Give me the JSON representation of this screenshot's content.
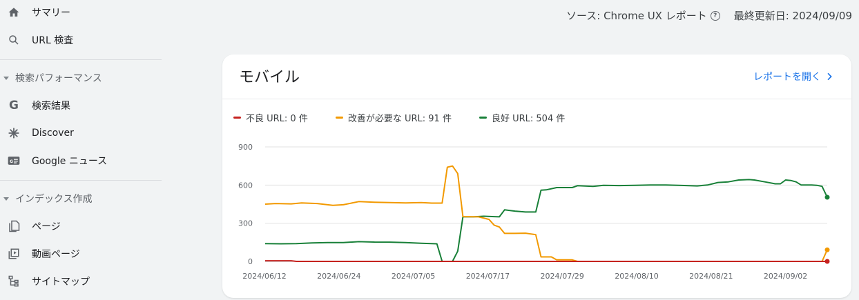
{
  "sidebar": {
    "items": [
      {
        "label": "サマリー",
        "icon": "home-icon"
      },
      {
        "label": "URL 検査",
        "icon": "search-icon"
      },
      {
        "label": "検索結果",
        "icon": "google-g-icon"
      },
      {
        "label": "Discover",
        "icon": "asterisk-icon"
      },
      {
        "label": "Google ニュース",
        "icon": "news-icon"
      },
      {
        "label": "ページ",
        "icon": "pages-icon"
      },
      {
        "label": "動画ページ",
        "icon": "video-page-icon"
      },
      {
        "label": "サイトマップ",
        "icon": "sitemap-icon"
      }
    ],
    "sections": [
      {
        "label": "検索パフォーマンス"
      },
      {
        "label": "インデックス作成"
      }
    ]
  },
  "source": {
    "label": "ソース: Chrome UX レポート",
    "updated": "最終更新日: 2024/09/09"
  },
  "card": {
    "title": "モバイル",
    "report_link": "レポートを開く"
  },
  "legend": [
    {
      "label": "不良 URL: 0 件",
      "color": "#c5221f"
    },
    {
      "label": "改善が必要な URL: 91 件",
      "color": "#f29900"
    },
    {
      "label": "良好 URL: 504 件",
      "color": "#188038"
    }
  ],
  "chart_data": {
    "type": "line",
    "x_tick_labels": [
      "2024/06/12",
      "2024/06/24",
      "2024/07/05",
      "2024/07/17",
      "2024/07/29",
      "2024/08/10",
      "2024/08/21",
      "2024/09/02"
    ],
    "y_ticks": [
      0,
      300,
      600,
      900
    ],
    "ylim": [
      0,
      900
    ],
    "x_range": [
      0,
      89
    ],
    "grid": true,
    "series": [
      {
        "name": "良好 URL",
        "color": "#188038",
        "points": [
          [
            0,
            140
          ],
          [
            3,
            138
          ],
          [
            6,
            140
          ],
          [
            9,
            145
          ],
          [
            12,
            148
          ],
          [
            15,
            148
          ],
          [
            18,
            155
          ],
          [
            21,
            152
          ],
          [
            24,
            151
          ],
          [
            27,
            148
          ],
          [
            30,
            142
          ],
          [
            33,
            138
          ],
          [
            34,
            0
          ],
          [
            36,
            0
          ],
          [
            37,
            80
          ],
          [
            38,
            350
          ],
          [
            40,
            350
          ],
          [
            42,
            355
          ],
          [
            44,
            352
          ],
          [
            45,
            350
          ],
          [
            46,
            405
          ],
          [
            48,
            395
          ],
          [
            50,
            388
          ],
          [
            52,
            388
          ],
          [
            53,
            560
          ],
          [
            54,
            562
          ],
          [
            56,
            580
          ],
          [
            59,
            580
          ],
          [
            60,
            595
          ],
          [
            63,
            590
          ],
          [
            65,
            598
          ],
          [
            68,
            596
          ],
          [
            71,
            598
          ],
          [
            74,
            600
          ],
          [
            77,
            600
          ],
          [
            80,
            597
          ],
          [
            83,
            593
          ],
          [
            85,
            600
          ],
          [
            87,
            620
          ],
          [
            89,
            625
          ],
          [
            91,
            640
          ],
          [
            93,
            643
          ],
          [
            94,
            640
          ],
          [
            96,
            625
          ],
          [
            98,
            610
          ],
          [
            99,
            610
          ],
          [
            100,
            640
          ],
          [
            101,
            636
          ],
          [
            102,
            625
          ],
          [
            103,
            600
          ],
          [
            105,
            600
          ],
          [
            106,
            598
          ],
          [
            107,
            590
          ],
          [
            108,
            504
          ]
        ]
      },
      {
        "name": "改善が必要な URL",
        "color": "#f29900",
        "points": [
          [
            0,
            450
          ],
          [
            2,
            455
          ],
          [
            5,
            452
          ],
          [
            7,
            460
          ],
          [
            10,
            455
          ],
          [
            13,
            440
          ],
          [
            15,
            445
          ],
          [
            18,
            470
          ],
          [
            21,
            465
          ],
          [
            24,
            462
          ],
          [
            27,
            460
          ],
          [
            30,
            462
          ],
          [
            32,
            458
          ],
          [
            34,
            458
          ],
          [
            35,
            740
          ],
          [
            36,
            750
          ],
          [
            37,
            690
          ],
          [
            38,
            352
          ],
          [
            41,
            350
          ],
          [
            43,
            330
          ],
          [
            44,
            285
          ],
          [
            45,
            270
          ],
          [
            46,
            220
          ],
          [
            48,
            220
          ],
          [
            50,
            222
          ],
          [
            52,
            210
          ],
          [
            53,
            35
          ],
          [
            55,
            35
          ],
          [
            56,
            12
          ],
          [
            59,
            12
          ],
          [
            60,
            0
          ],
          [
            107,
            0
          ],
          [
            108,
            91
          ]
        ]
      },
      {
        "name": "不良 URL",
        "color": "#c5221f",
        "points": [
          [
            0,
            5
          ],
          [
            5,
            5
          ],
          [
            6,
            0
          ],
          [
            108,
            0
          ]
        ]
      }
    ]
  }
}
